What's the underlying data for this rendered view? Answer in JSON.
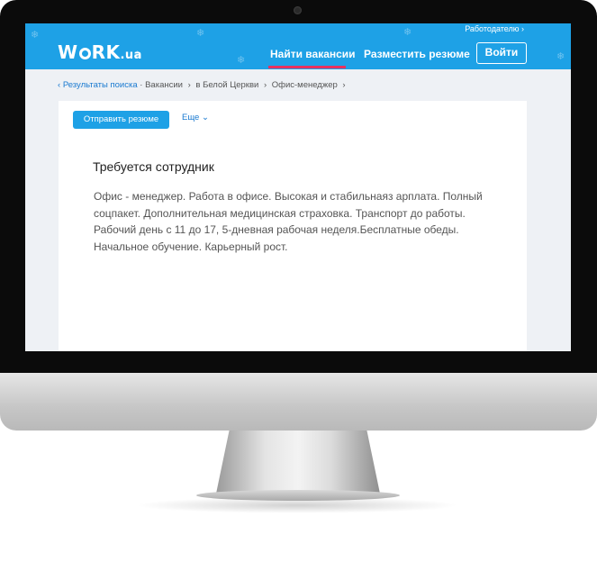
{
  "header": {
    "employer_link": "Работодателю",
    "logo_prefix": "W",
    "logo_middle": "RK",
    "logo_suffix": ".ua",
    "nav_find": "Найти вакансии",
    "nav_post_resume": "Разместить резюме",
    "login_label": "Войти"
  },
  "breadcrumb": {
    "back": "Результаты поиска",
    "separator": "·",
    "items": [
      "Вакансии",
      "в Белой Церкви",
      "Офис-менеджер"
    ]
  },
  "actions": {
    "send_resume": "Отправить резюме",
    "more": "Еще"
  },
  "vacancy": {
    "title": "Требуется сотрудник",
    "description": "Офис - менеджер. Работа в офисе. Высокая и стабильнаяз арплата. Полный соцпакет. Дополнительная медицинская страховка. Транспорт до работы. Рабочий день с 11 до 17, 5-дневная рабочая неделя.Бесплатные обеды. Начальное обучение. Карьерный рост."
  },
  "colors": {
    "header_bg": "#1ea1e6",
    "active_underline": "#e8315f",
    "link": "#1a7ad0"
  },
  "icons": {
    "chevron_right": "›",
    "chevron_left": "‹",
    "chevron_down": "⌄"
  }
}
